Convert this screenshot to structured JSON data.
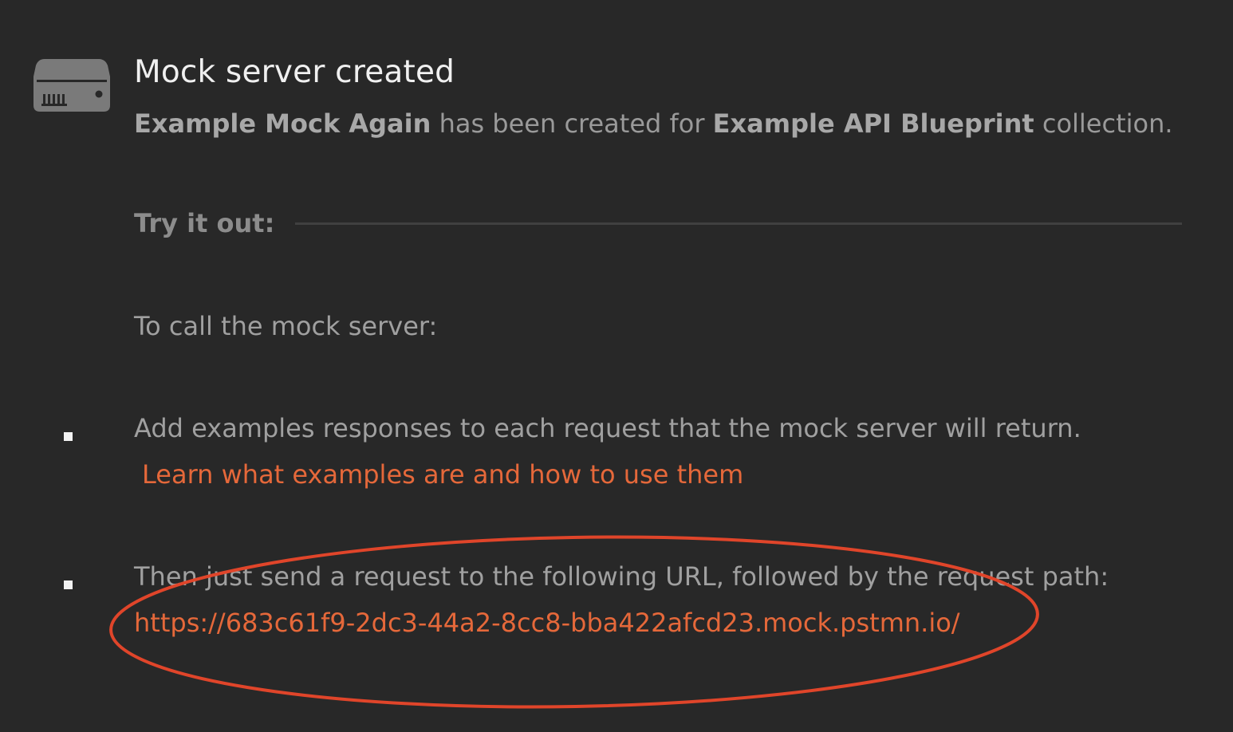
{
  "icons": {
    "header": "server-icon",
    "bullet": "square-bullet-icon"
  },
  "colors": {
    "background": "#282828",
    "title": "#f0f0f0",
    "body_text": "#a0a0a0",
    "link": "#e5683a",
    "annotation": "#e0452a"
  },
  "header": {
    "title": "Mock server created",
    "subtitle": {
      "mock_name": "Example Mock Again",
      "middle_text": " has been created for ",
      "collection_name": "Example API Blueprint",
      "end_text": " collection."
    }
  },
  "try_it_out": {
    "label": "Try it out:"
  },
  "instructions": {
    "intro": "To call the mock server:",
    "items": [
      {
        "text": "Add examples responses to each request that the mock server will return.",
        "link": "Learn what examples are and how to use them"
      },
      {
        "text": "Then just send a request to the following URL, followed by the request path:",
        "link": "https://683c61f9-2dc3-44a2-8cc8-bba422afcd23.mock.pstmn.io/"
      }
    ]
  }
}
